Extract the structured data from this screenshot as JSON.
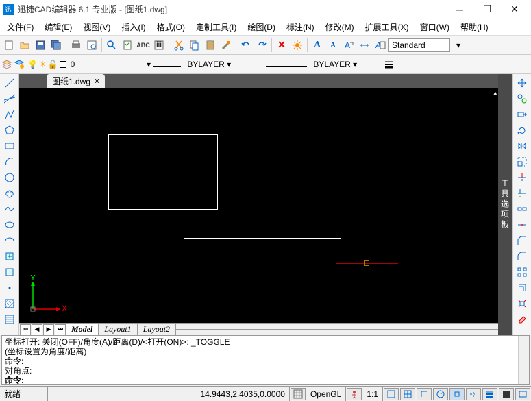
{
  "titlebar": {
    "app_logo": "迅",
    "title": "迅捷CAD编辑器 6.1 专业版  -  [图纸1.dwg]"
  },
  "menus": {
    "file": "文件(F)",
    "edit": "编辑(E)",
    "view": "视图(V)",
    "insert": "插入(I)",
    "format": "格式(O)",
    "custom_tool": "定制工具(I)",
    "draw": "绘图(D)",
    "annotate": "标注(N)",
    "modify": "修改(M)",
    "extend_tool": "扩展工具(X)",
    "window": "窗口(W)",
    "help": "帮助(H)"
  },
  "toolbar1": {
    "style_label": "Standard"
  },
  "toolbar2": {
    "layer_name": "0",
    "linetype": "BYLAYER",
    "lineweight": "BYLAYER"
  },
  "tab": {
    "name": "图纸1.dwg",
    "close": "×"
  },
  "panelright": {
    "label": "工具选项板"
  },
  "ucs": {
    "y": "Y",
    "x": "X"
  },
  "modeltabs": {
    "model": "Model",
    "layout1": "Layout1",
    "layout2": "Layout2"
  },
  "command": {
    "line1": "坐标打开:  关闭(OFF)/角度(A)/距离(D)/<打开(ON)>: _TOGGLE",
    "line2": " (坐标设置为角度/距离)",
    "line3": "命令:",
    "line4": "对角点:",
    "line5": "命令:"
  },
  "statusbar": {
    "ready": "就绪",
    "coords": "14.9443,2.4035,0.0000",
    "renderer": "OpenGL",
    "ratio": "1:1"
  }
}
